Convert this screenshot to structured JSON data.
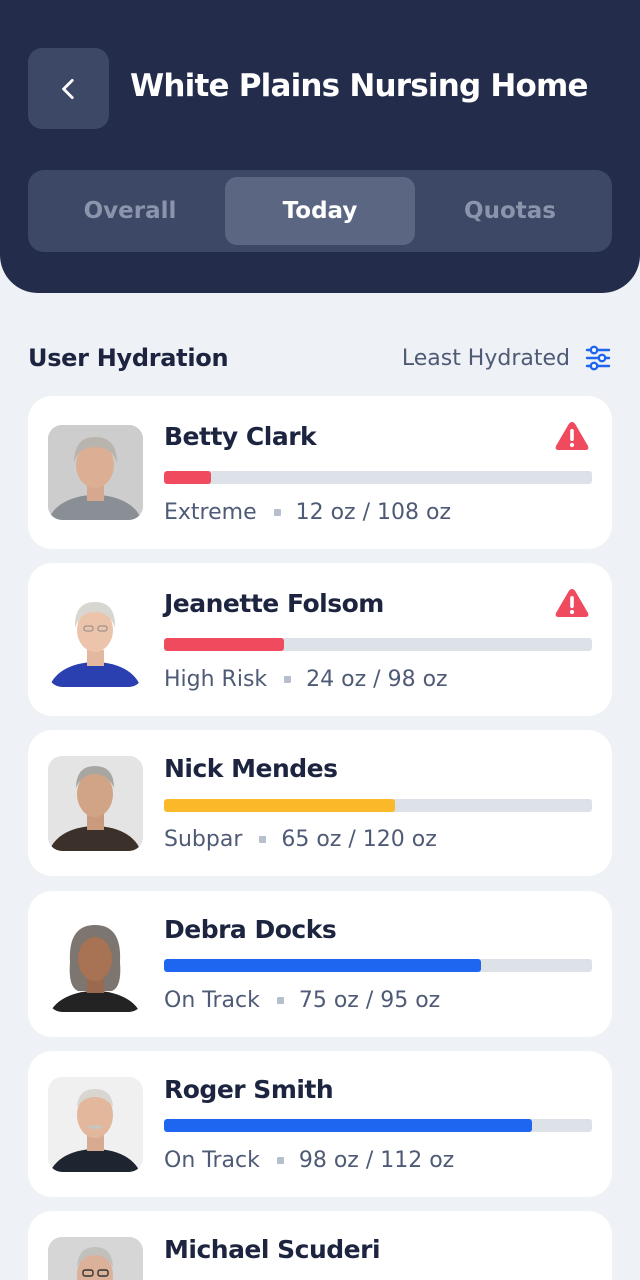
{
  "header": {
    "title": "White Plains Nursing Home",
    "tabs": [
      {
        "label": "Overall",
        "active": false
      },
      {
        "label": "Today",
        "active": true
      },
      {
        "label": "Quotas",
        "active": false
      }
    ]
  },
  "section": {
    "title": "User Hydration",
    "sort_label": "Least Hydrated"
  },
  "colors": {
    "header_bg": "#232c4a",
    "risk_red": "#f04a5e",
    "subpar_yellow": "#fbb929",
    "on_track_blue": "#1e66f0",
    "accent": "#1e66f0"
  },
  "residents": [
    {
      "name": "Betty Clark",
      "status": "Extreme",
      "consumed": "12 oz",
      "goal": "/ 108 oz",
      "progress": 0.11,
      "color": "#f04a5e",
      "alert": true,
      "icon": "alert-icon"
    },
    {
      "name": "Jeanette Folsom",
      "status": "High Risk",
      "consumed": "24 oz",
      "goal": "/ 98 oz",
      "progress": 0.28,
      "color": "#f04a5e",
      "alert": true,
      "icon": "alert-icon"
    },
    {
      "name": "Nick Mendes",
      "status": "Subpar",
      "consumed": "65 oz",
      "goal": "/ 120 oz",
      "progress": 0.54,
      "color": "#fbb929",
      "alert": false
    },
    {
      "name": "Debra Docks",
      "status": "On Track",
      "consumed": "75 oz",
      "goal": "/ 95 oz",
      "progress": 0.74,
      "color": "#1e66f0",
      "alert": false
    },
    {
      "name": "Roger Smith",
      "status": "On Track",
      "consumed": "98 oz",
      "goal": "/ 112 oz",
      "progress": 0.86,
      "color": "#1e66f0",
      "alert": false
    },
    {
      "name": "Michael Scuderi",
      "status": "",
      "consumed": "",
      "goal": "",
      "progress": null,
      "color": "",
      "alert": false
    }
  ]
}
